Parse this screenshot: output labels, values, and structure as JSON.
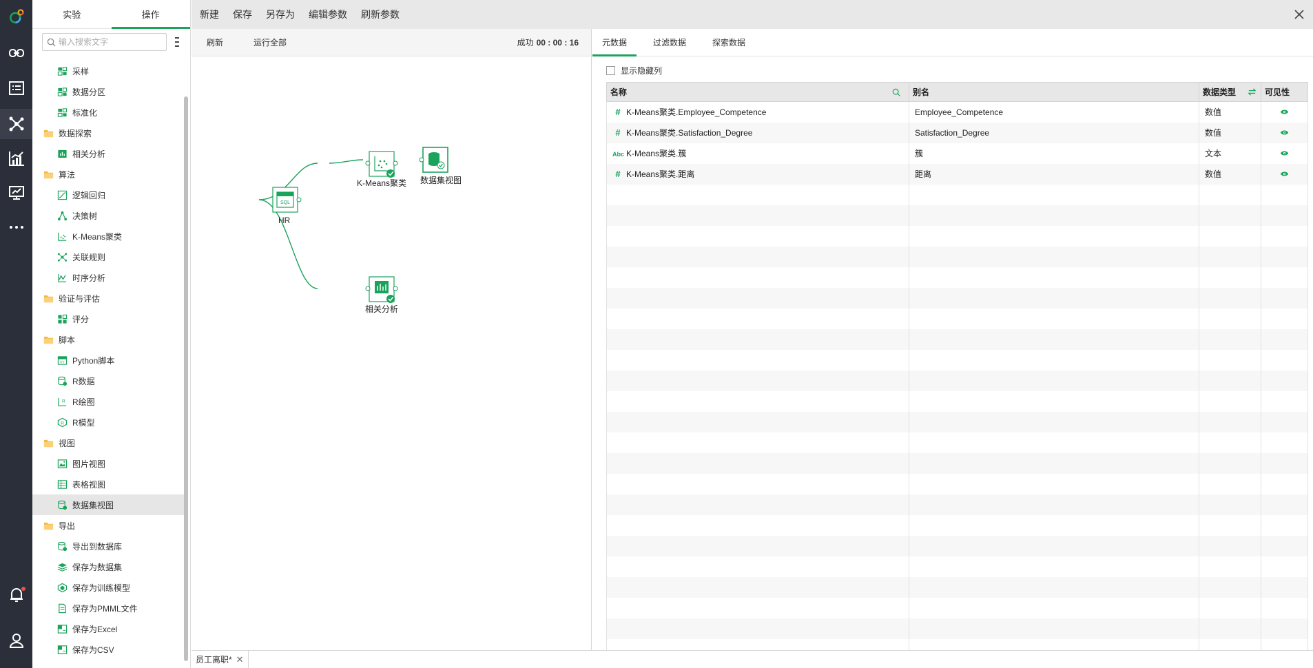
{
  "panel": {
    "tabs": [
      "实验",
      "操作"
    ],
    "active_tab": 1,
    "search_placeholder": "输入搜索文字",
    "tree": [
      {
        "type": "leaf",
        "label": "采样",
        "icon": "sample-icon"
      },
      {
        "type": "leaf",
        "label": "数据分区",
        "icon": "partition-icon"
      },
      {
        "type": "leaf",
        "label": "标准化",
        "icon": "normalize-icon"
      },
      {
        "type": "folder",
        "label": "数据探索",
        "icon": "folder-icon"
      },
      {
        "type": "leaf",
        "label": "相关分析",
        "icon": "correlation-icon"
      },
      {
        "type": "folder",
        "label": "算法",
        "icon": "folder-icon"
      },
      {
        "type": "leaf",
        "label": "逻辑回归",
        "icon": "logistic-regression-icon"
      },
      {
        "type": "leaf",
        "label": "决策树",
        "icon": "decision-tree-icon"
      },
      {
        "type": "leaf",
        "label": "K-Means聚类",
        "icon": "kmeans-icon"
      },
      {
        "type": "leaf",
        "label": "关联规则",
        "icon": "association-rule-icon"
      },
      {
        "type": "leaf",
        "label": "时序分析",
        "icon": "time-series-icon"
      },
      {
        "type": "folder",
        "label": "验证与评估",
        "icon": "folder-icon"
      },
      {
        "type": "leaf",
        "label": "评分",
        "icon": "score-icon"
      },
      {
        "type": "folder",
        "label": "脚本",
        "icon": "folder-icon"
      },
      {
        "type": "leaf",
        "label": "Python脚本",
        "icon": "python-script-icon"
      },
      {
        "type": "leaf",
        "label": "R数据",
        "icon": "r-data-icon"
      },
      {
        "type": "leaf",
        "label": "R绘图",
        "icon": "r-plot-icon"
      },
      {
        "type": "leaf",
        "label": "R模型",
        "icon": "r-model-icon"
      },
      {
        "type": "folder",
        "label": "视图",
        "icon": "folder-icon"
      },
      {
        "type": "leaf",
        "label": "图片视图",
        "icon": "image-view-icon"
      },
      {
        "type": "leaf",
        "label": "表格视图",
        "icon": "table-view-icon"
      },
      {
        "type": "leaf",
        "label": "数据集视图",
        "icon": "dataset-view-icon",
        "selected": true
      },
      {
        "type": "folder",
        "label": "导出",
        "icon": "folder-icon"
      },
      {
        "type": "leaf",
        "label": "导出到数据库",
        "icon": "export-db-icon"
      },
      {
        "type": "leaf",
        "label": "保存为数据集",
        "icon": "save-dataset-icon"
      },
      {
        "type": "leaf",
        "label": "保存为训练模型",
        "icon": "save-model-icon"
      },
      {
        "type": "leaf",
        "label": "保存为PMML文件",
        "icon": "save-pmml-icon"
      },
      {
        "type": "leaf",
        "label": "保存为Excel",
        "icon": "save-excel-icon"
      },
      {
        "type": "leaf",
        "label": "保存为CSV",
        "icon": "save-csv-icon"
      }
    ]
  },
  "toolbar": {
    "buttons": [
      "新建",
      "保存",
      "另存为",
      "编辑参数",
      "刷新参数"
    ]
  },
  "canvas": {
    "refresh_label": "刷新",
    "run_all_label": "运行全部",
    "status_label": "成功",
    "status_time": "00 : 00 : 16",
    "nodes": {
      "hr": "HR",
      "kmeans": "K-Means聚类",
      "dataset_view": "数据集视图",
      "correlation": "相关分析"
    }
  },
  "right": {
    "tabs": [
      "元数据",
      "过滤数据",
      "探索数据"
    ],
    "active_tab": 0,
    "show_hidden_label": "显示隐藏列",
    "columns": [
      "名称",
      "别名",
      "数据类型",
      "可见性"
    ],
    "rows": [
      {
        "type_icon": "#",
        "name": "K-Means聚类.Employee_Competence",
        "alias": "Employee_Competence",
        "dtype": "数值"
      },
      {
        "type_icon": "#",
        "name": "K-Means聚类.Satisfaction_Degree",
        "alias": "Satisfaction_Degree",
        "dtype": "数值"
      },
      {
        "type_icon": "Abc",
        "name": "K-Means聚类.簇",
        "alias": "簇",
        "dtype": "文本"
      },
      {
        "type_icon": "#",
        "name": "K-Means聚类.距离",
        "alias": "距离",
        "dtype": "数值"
      }
    ],
    "empty_rows": 23
  },
  "bottom": {
    "file_tab": "员工离职*"
  },
  "colors": {
    "accent": "#1aa35a",
    "rail": "#2b2f3a"
  }
}
